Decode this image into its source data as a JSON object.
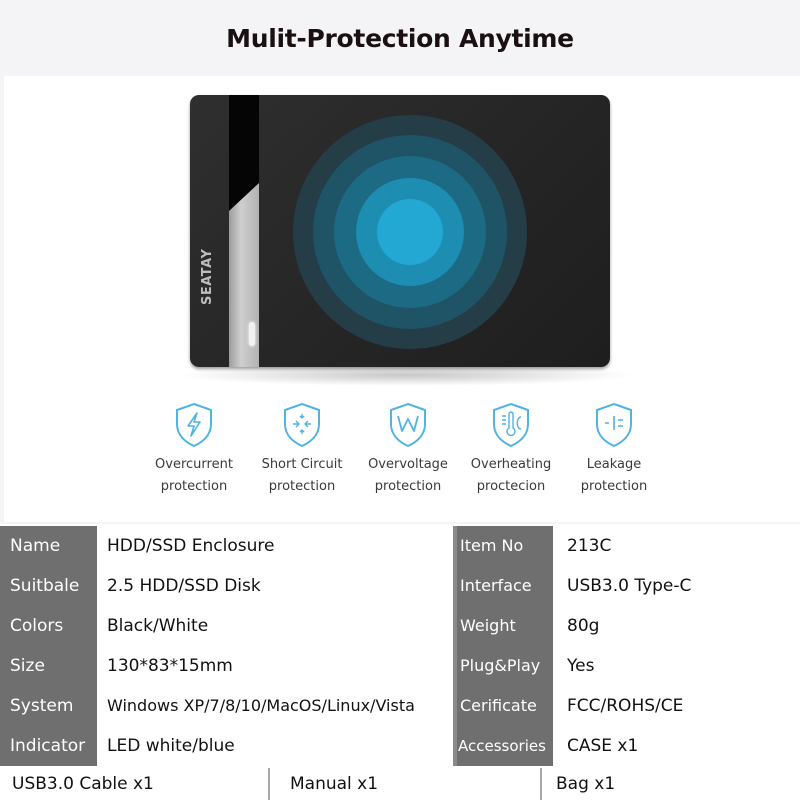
{
  "header": {
    "title": "Mulit-Protection Anytime"
  },
  "product": {
    "brand": "SEATAY"
  },
  "features": [
    {
      "icon": "lightning-shield-icon",
      "line1": "Overcurrent",
      "line2": "protection"
    },
    {
      "icon": "short-circuit-shield-icon",
      "line1": "Short Circuit",
      "line2": "protection"
    },
    {
      "icon": "voltage-shield-icon",
      "line1": "Overvoltage",
      "line2": "protection"
    },
    {
      "icon": "thermometer-shield-icon",
      "line1": "Overheating",
      "line2": "proctecion"
    },
    {
      "icon": "leakage-shield-icon",
      "line1": "Leakage",
      "line2": "protection"
    }
  ],
  "colors": {
    "accent": "#4fb3e3",
    "label_bg": "#6f6f6f",
    "title": "#1a1011"
  },
  "specs": [
    {
      "k1": "Name",
      "v1": "HDD/SSD Enclosure",
      "k2": "Item No",
      "v2": "213C"
    },
    {
      "k1": "Suitbale",
      "v1": "2.5 HDD/SSD Disk",
      "k2": "Interface",
      "v2": "USB3.0 Type-C"
    },
    {
      "k1": "Colors",
      "v1": "Black/White",
      "k2": "Weight",
      "v2": "80g"
    },
    {
      "k1": "Size",
      "v1": "130*83*15mm",
      "k2": "Plug&Play",
      "v2": "Yes"
    },
    {
      "k1": "System",
      "v1": "Windows XP/7/8/10/MacOS/Linux/Vista",
      "k2": "Cerificate",
      "v2": "FCC/ROHS/CE"
    },
    {
      "k1": "Indicator",
      "v1": "LED white/blue",
      "k2": "Accessories",
      "v2": "CASE x1"
    }
  ],
  "accessories": [
    "USB3.0 Cable x1",
    "Manual x1",
    "Bag x1"
  ]
}
